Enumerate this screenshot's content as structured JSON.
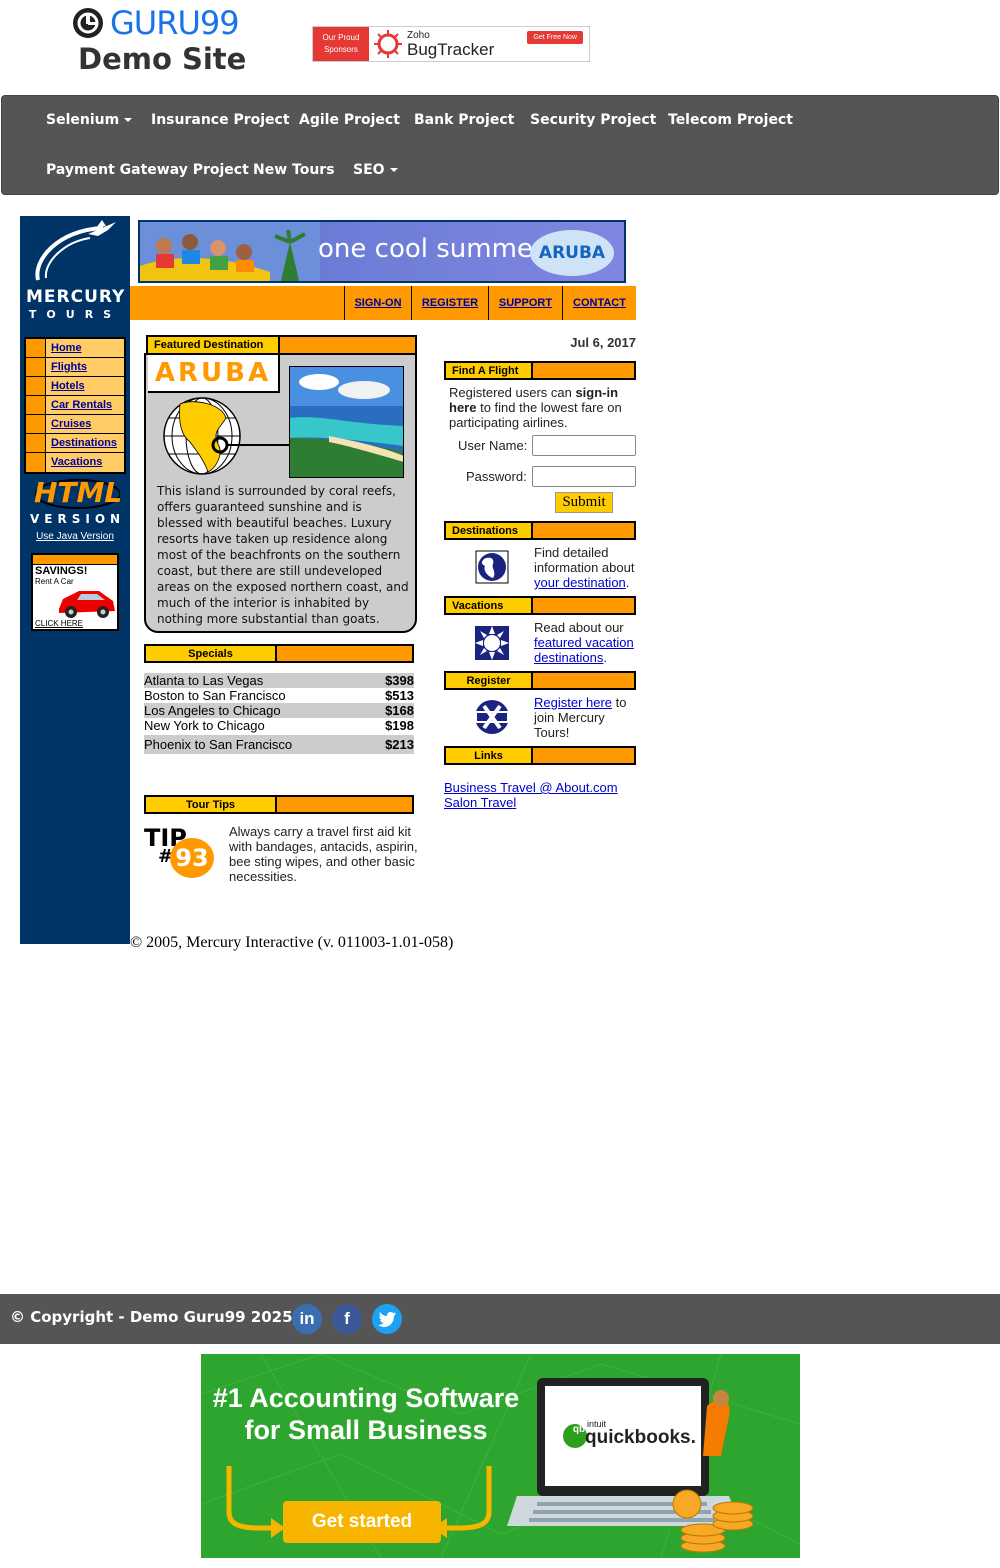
{
  "header": {
    "logo_text": "GURU99",
    "subtitle": "Demo Site",
    "sponsor": {
      "left_text": "Our Proud Sponsors",
      "brand_small": "Zoho",
      "brand_big": "BugTracker",
      "cta": "Get Free Now"
    }
  },
  "nav": {
    "row1": [
      "Selenium",
      "Insurance Project",
      "Agile Project",
      "Bank Project",
      "Security Project",
      "Telecom Project"
    ],
    "row2": [
      "Payment Gateway Project",
      "New Tours",
      "SEO"
    ]
  },
  "mercury": {
    "logo_line1": "MERCURY",
    "logo_line2": "TOURS",
    "side_menu": [
      "Home",
      "Flights",
      "Hotels",
      "Car Rentals",
      "Cruises",
      "Destinations",
      "Vacations"
    ],
    "html_version_1": "HTML",
    "html_version_2": "VERSION",
    "java_link": "Use Java Version",
    "savings_title": "SAVINGS!",
    "savings_sub": "Rent A Car",
    "savings_click": "CLICK HERE",
    "banner_text": "one cool summer",
    "banner_logo": "ARUBA",
    "top_links": [
      "SIGN-ON",
      "REGISTER",
      "SUPPORT",
      "CONTACT"
    ],
    "featured": {
      "title": "Featured Destination",
      "name": "ARUBA",
      "description": "This island is surrounded by coral reefs, offers guaranteed sunshine and is blessed with beautiful beaches. Luxury resorts have taken up residence along most of the beachfronts on the southern coast, but there are still undeveloped areas on the exposed northern coast, and much of the interior is inhabited by nothing more substantial than goats."
    },
    "specials": {
      "title": "Specials",
      "rows": [
        {
          "route": "Atlanta to Las Vegas",
          "price": "$398"
        },
        {
          "route": "Boston to San Francisco",
          "price": "$513"
        },
        {
          "route": "Los Angeles to Chicago",
          "price": "$168"
        },
        {
          "route": "New York to Chicago",
          "price": "$198"
        },
        {
          "route": "Phoenix to San Francisco",
          "price": "$213"
        }
      ]
    },
    "tour_tips": {
      "title": "Tour Tips",
      "tip_word": "TIP",
      "tip_hash": "#",
      "tip_num": "93",
      "text": "Always carry a travel first aid kit with bandages, antacids, aspirin, bee sting wipes, and other basic necessities."
    },
    "date": "Jul 6, 2017",
    "find_flight": {
      "title": "Find A Flight",
      "intro_1": "Registered users can ",
      "intro_bold": "sign-in here",
      "intro_2": " to find the lowest fare on participating airlines.",
      "username_label": "User Name:",
      "password_label": "Password:",
      "submit": "Submit"
    },
    "destinations": {
      "title": "Destinations",
      "text_1": "Find detailed information about ",
      "link": "your destination",
      "text_2": "."
    },
    "vacations": {
      "title": "Vacations",
      "text_1": "Read about our ",
      "link": "featured vacation destinations",
      "text_2": "."
    },
    "register": {
      "title": "Register",
      "link": "Register here",
      "text": " to join Mercury Tours!"
    },
    "links": {
      "title": "Links",
      "items": [
        "Business Travel @ About.com",
        "Salon Travel"
      ]
    },
    "copyright": "© 2005, Mercury Interactive (v. 011003-1.01-058)"
  },
  "footer": {
    "copyright": "© Copyright - Demo Guru99 2025",
    "social": [
      "in",
      "f",
      "t"
    ]
  },
  "ad": {
    "line1": "#1 Accounting Software",
    "line2": "for Small Business",
    "cta": "Get started",
    "brand_small": "intuit",
    "brand": "quickbooks."
  }
}
